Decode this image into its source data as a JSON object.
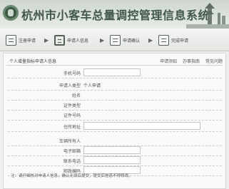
{
  "header": {
    "title": "杭州市小客车总量调控管理信息系统"
  },
  "steps": [
    {
      "label": "注册申请",
      "active": false
    },
    {
      "label": "申请人信息",
      "active": true
    },
    {
      "label": "申请确认",
      "active": false
    },
    {
      "label": "完成申请",
      "active": false
    }
  ],
  "form": {
    "section_title": "个人增量指标申请人信息",
    "links": [
      "申请须知",
      "办事指南",
      "常见问题"
    ],
    "rows": [
      {
        "label": "手机号码",
        "value": ""
      },
      {
        "label": "申请人类型",
        "value": "个人申请"
      },
      {
        "label": "姓名",
        "value": ""
      },
      {
        "label": "证件类型",
        "value": ""
      },
      {
        "label": "证件号码",
        "value": ""
      },
      {
        "label": "住所地址",
        "value": ""
      },
      {
        "label": "车辆所有人",
        "value": ""
      },
      {
        "label": "电子邮箱",
        "value": ""
      },
      {
        "label": "联系电话",
        "value": ""
      },
      {
        "label": "邮政编码",
        "value": ""
      }
    ],
    "notice": "注：请仔细核对申请人信息，确认无误后提交，提交后信息不得修改。"
  }
}
